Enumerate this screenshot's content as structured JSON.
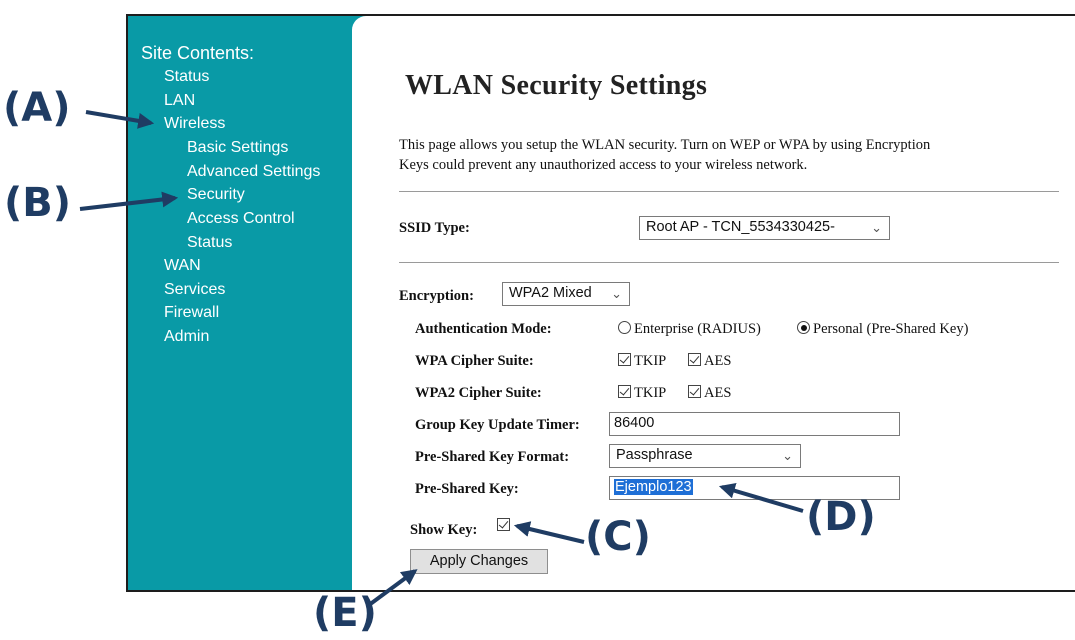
{
  "sidebar": {
    "heading": "Site Contents:",
    "items": [
      {
        "label": "Status"
      },
      {
        "label": "LAN"
      },
      {
        "label": "Wireless"
      },
      {
        "label": "Basic Settings"
      },
      {
        "label": "Advanced Settings"
      },
      {
        "label": "Security"
      },
      {
        "label": "Access Control"
      },
      {
        "label": "Status"
      },
      {
        "label": "WAN"
      },
      {
        "label": "Services"
      },
      {
        "label": "Firewall"
      },
      {
        "label": "Admin"
      }
    ]
  },
  "page": {
    "title": "WLAN Security Settings",
    "description_line1": "This page allows you setup the WLAN security. Turn on WEP or WPA by using Encryption",
    "description_line2": "Keys could prevent any unauthorized access to your wireless network."
  },
  "form": {
    "ssid_type_label": "SSID Type:",
    "ssid_type_value": "Root AP - TCN_5534330425-",
    "encryption_label": "Encryption:",
    "encryption_value": "WPA2 Mixed",
    "auth_mode_label": "Authentication Mode:",
    "auth_enterprise": "Enterprise (RADIUS)",
    "auth_personal": "Personal (Pre-Shared Key)",
    "wpa_cipher_label": "WPA Cipher Suite:",
    "wpa2_cipher_label": "WPA2 Cipher Suite:",
    "cipher_tkip": "TKIP",
    "cipher_aes": "AES",
    "group_key_label": "Group Key Update Timer:",
    "group_key_value": "86400",
    "psk_format_label": "Pre-Shared Key Format:",
    "psk_format_value": "Passphrase",
    "psk_label": "Pre-Shared Key:",
    "psk_value": "Ejemplo123",
    "show_key_label": "Show Key:",
    "apply_label": "Apply Changes"
  },
  "callouts": {
    "a": "(A)",
    "b": "(B)",
    "c": "(C)",
    "d": "(D)",
    "e": "(E)"
  },
  "colors": {
    "sidebar_bg": "#099aa6",
    "callout": "#1f3c63",
    "selection": "#1e6fd6"
  }
}
